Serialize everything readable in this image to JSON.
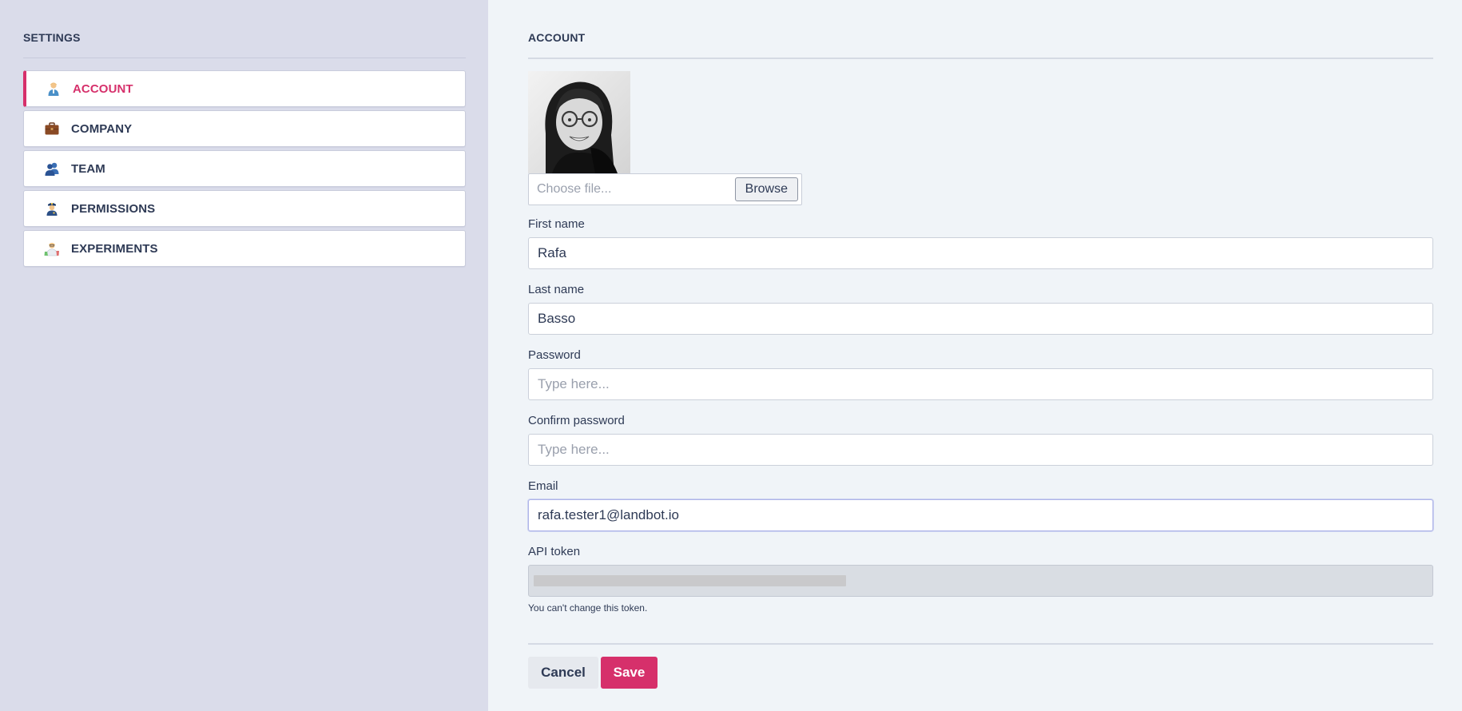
{
  "sidebar": {
    "title": "SETTINGS",
    "items": [
      {
        "label": "ACCOUNT",
        "icon": "person-icon",
        "active": true
      },
      {
        "label": "COMPANY",
        "icon": "briefcase-icon",
        "active": false
      },
      {
        "label": "TEAM",
        "icon": "people-icon",
        "active": false
      },
      {
        "label": "PERMISSIONS",
        "icon": "officer-icon",
        "active": false
      },
      {
        "label": "EXPERIMENTS",
        "icon": "scientist-icon",
        "active": false
      }
    ]
  },
  "main": {
    "title": "ACCOUNT",
    "avatar": {
      "icon": "profile-photo"
    },
    "file_upload": {
      "placeholder": "Choose file...",
      "browse_label": "Browse"
    },
    "fields": {
      "first_name": {
        "label": "First name",
        "value": "Rafa",
        "placeholder": ""
      },
      "last_name": {
        "label": "Last name",
        "value": "Basso",
        "placeholder": ""
      },
      "password": {
        "label": "Password",
        "value": "",
        "placeholder": "Type here..."
      },
      "confirm_password": {
        "label": "Confirm password",
        "value": "",
        "placeholder": "Type here..."
      },
      "email": {
        "label": "Email",
        "value": "rafa.tester1@landbot.io",
        "placeholder": ""
      },
      "api_token": {
        "label": "API token",
        "help": "You can't change this token."
      }
    },
    "actions": {
      "cancel_label": "Cancel",
      "save_label": "Save"
    }
  },
  "colors": {
    "accent": "#d6306b",
    "sidebar_bg": "#dadcea",
    "main_bg": "#f0f4f8",
    "text": "#2e3a55"
  }
}
